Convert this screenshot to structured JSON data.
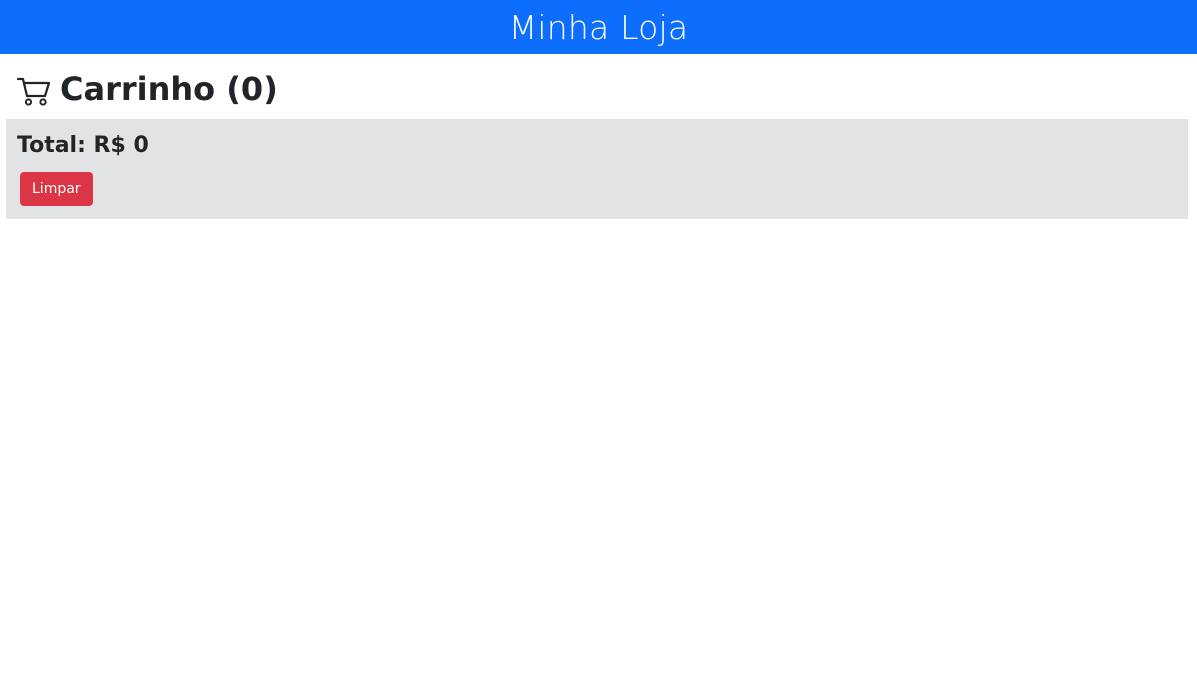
{
  "header": {
    "store_name": "Minha Loja",
    "color": "#0d6efd"
  },
  "cart": {
    "icon": "shopping-cart-icon",
    "title": "Carrinho (0)"
  },
  "summary": {
    "total_label": "Total: R$ 0",
    "clear_label": "Limpar",
    "clear_color": "#dc3545"
  }
}
